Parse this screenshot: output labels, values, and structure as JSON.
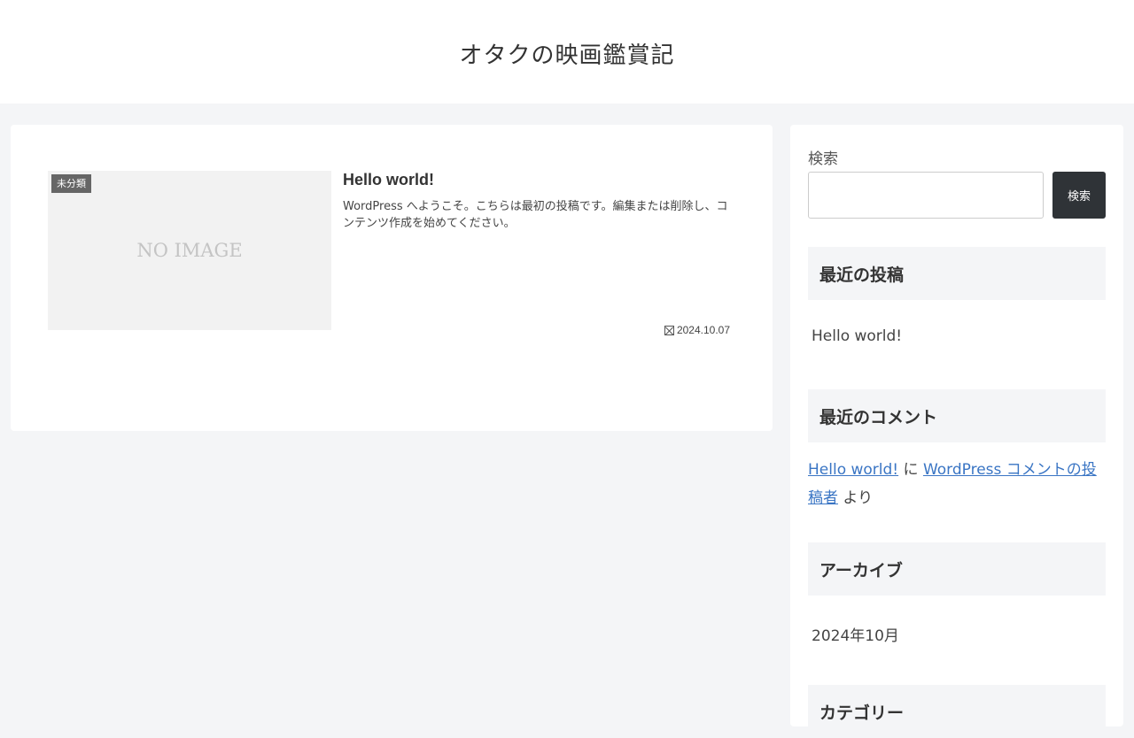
{
  "site": {
    "title": "オタクの映画鑑賞記"
  },
  "post": {
    "category": "未分類",
    "thumb_text": "NO IMAGE",
    "title": "Hello world!",
    "snippet": "WordPress へようこそ。こちらは最初の投稿です。編集または削除し、コンテンツ作成を始めてください。",
    "date": "2024.10.07"
  },
  "sidebar": {
    "search_label": "検索",
    "search_button": "検索",
    "search_value": "",
    "recent_posts_title": "最近の投稿",
    "recent_posts": [
      "Hello world!"
    ],
    "recent_comments_title": "最近のコメント",
    "comment": {
      "post": "Hello world!",
      "sep": " に ",
      "author": "WordPress コメントの投稿者",
      "suffix": " より"
    },
    "archive_title": "アーカイブ",
    "archives": [
      "2024年10月"
    ],
    "category_title": "カテゴリー"
  }
}
